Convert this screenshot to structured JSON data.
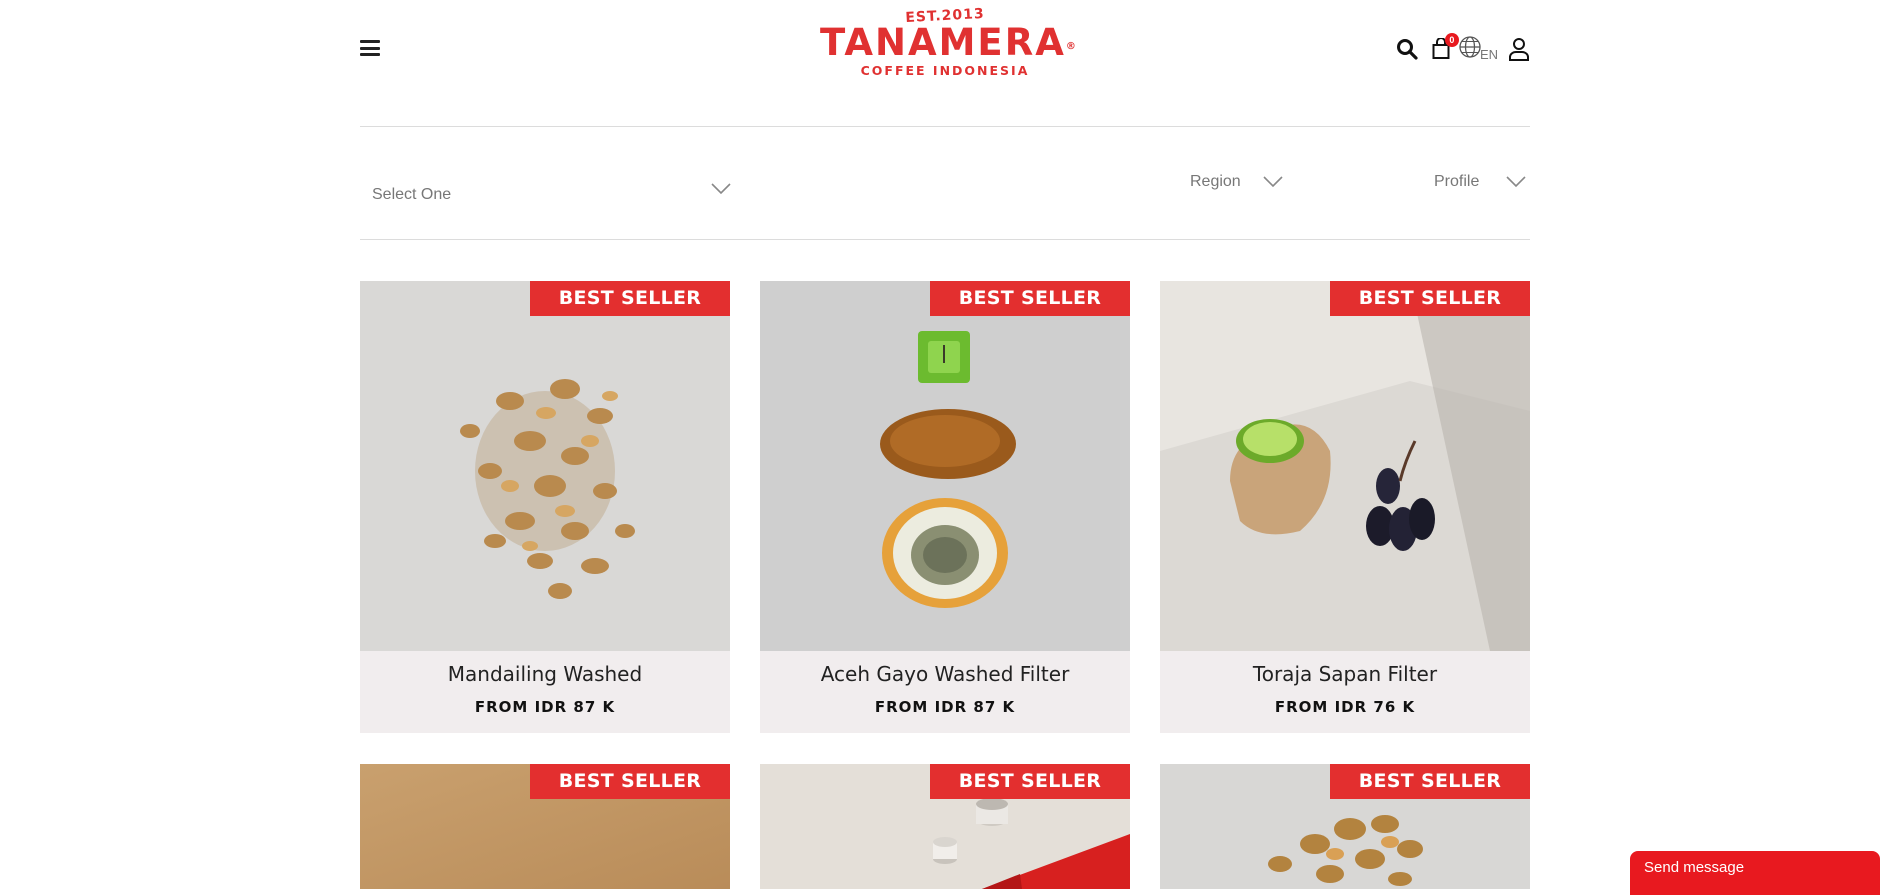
{
  "header": {
    "logo": {
      "est": "EST.2013",
      "brand": "TANAMERA",
      "subtitle": "COFFEE INDONESIA"
    },
    "cart_count": "0",
    "language": "EN",
    "icons": [
      "hamburger-icon",
      "search-icon",
      "cart-icon",
      "globe-icon",
      "user-icon"
    ]
  },
  "filters": {
    "category": "Select One",
    "region": "Region",
    "profile": "Profile"
  },
  "products": [
    {
      "badge": "BEST SELLER",
      "name": "Mandailing Washed",
      "price": "FROM IDR 87 K"
    },
    {
      "badge": "BEST SELLER",
      "name": "Aceh Gayo Washed Filter",
      "price": "FROM IDR 87 K"
    },
    {
      "badge": "BEST SELLER",
      "name": "Toraja Sapan Filter",
      "price": "FROM IDR 76 K"
    },
    {
      "badge": "BEST SELLER"
    },
    {
      "badge": "BEST SELLER"
    },
    {
      "badge": "BEST SELLER"
    }
  ],
  "chat": {
    "label": "Send message"
  },
  "colors": {
    "brand_red": "#e03131",
    "badge_red": "#e32f2f",
    "card_bg": "#f1edee"
  }
}
